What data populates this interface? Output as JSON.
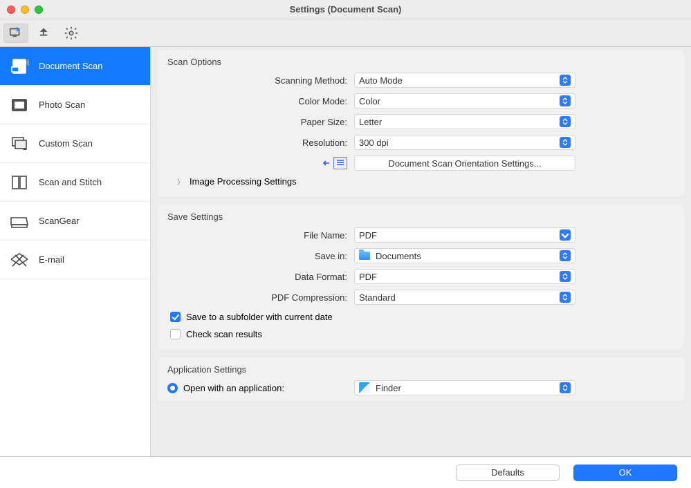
{
  "window": {
    "title": "Settings (Document Scan)"
  },
  "sidebar": {
    "items": [
      {
        "label": "Document Scan"
      },
      {
        "label": "Photo Scan"
      },
      {
        "label": "Custom Scan"
      },
      {
        "label": "Scan and Stitch"
      },
      {
        "label": "ScanGear"
      },
      {
        "label": "E-mail"
      }
    ]
  },
  "scanOptions": {
    "title": "Scan Options",
    "scanningMethod": {
      "label": "Scanning Method:",
      "value": "Auto Mode"
    },
    "colorMode": {
      "label": "Color Mode:",
      "value": "Color"
    },
    "paperSize": {
      "label": "Paper Size:",
      "value": "Letter"
    },
    "resolution": {
      "label": "Resolution:",
      "value": "300 dpi"
    },
    "orientationButton": "Document Scan Orientation Settings...",
    "imageProcessing": "Image Processing Settings"
  },
  "saveSettings": {
    "title": "Save Settings",
    "fileName": {
      "label": "File Name:",
      "value": "PDF"
    },
    "saveIn": {
      "label": "Save in:",
      "value": "Documents"
    },
    "dataFormat": {
      "label": "Data Format:",
      "value": "PDF"
    },
    "pdfCompression": {
      "label": "PDF Compression:",
      "value": "Standard"
    },
    "subfolder": "Save to a subfolder with current date",
    "checkResults": "Check scan results"
  },
  "appSettings": {
    "title": "Application Settings",
    "openWith": {
      "label": "Open with an application:",
      "value": "Finder"
    }
  },
  "buttons": {
    "defaults": "Defaults",
    "ok": "OK"
  }
}
